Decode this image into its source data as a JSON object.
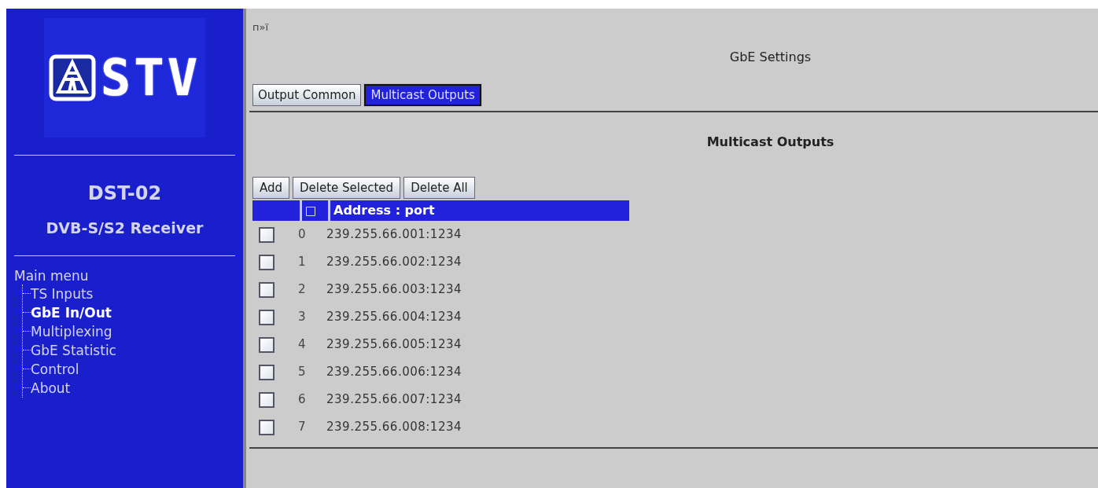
{
  "sidebar": {
    "logo_text": "STV",
    "model": "DST-02",
    "product": "DVB-S/S2 Receiver",
    "menu_title": "Main menu",
    "items": [
      {
        "label": "TS Inputs",
        "selected": false
      },
      {
        "label": "GbE In/Out",
        "selected": true
      },
      {
        "label": "Multiplexing",
        "selected": false
      },
      {
        "label": "GbE Statistic",
        "selected": false
      },
      {
        "label": "Control",
        "selected": false
      },
      {
        "label": "About",
        "selected": false
      }
    ]
  },
  "main": {
    "garbled_text": "п»ї",
    "title": "GbE Settings",
    "tabs": [
      {
        "label": "Output Common",
        "selected": false
      },
      {
        "label": "Multicast Outputs",
        "selected": true
      }
    ],
    "section_title": "Multicast Outputs",
    "buttons": [
      "Add",
      "Delete Selected",
      "Delete All"
    ],
    "table": {
      "columns": [
        "□",
        "Address : port"
      ],
      "rows": [
        {
          "checked": false,
          "index": "0",
          "address": "239.255.66.001:1234"
        },
        {
          "checked": false,
          "index": "1",
          "address": "239.255.66.002:1234"
        },
        {
          "checked": false,
          "index": "2",
          "address": "239.255.66.003:1234"
        },
        {
          "checked": false,
          "index": "3",
          "address": "239.255.66.004:1234"
        },
        {
          "checked": false,
          "index": "4",
          "address": "239.255.66.005:1234"
        },
        {
          "checked": false,
          "index": "5",
          "address": "239.255.66.006:1234"
        },
        {
          "checked": false,
          "index": "6",
          "address": "239.255.66.007:1234"
        },
        {
          "checked": false,
          "index": "7",
          "address": "239.255.66.008:1234"
        }
      ]
    }
  }
}
